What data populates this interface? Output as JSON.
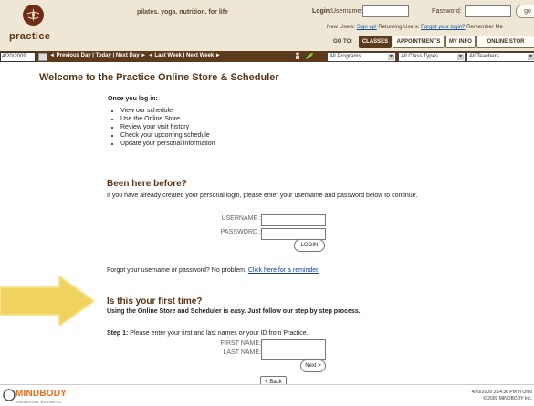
{
  "header": {
    "brand": "practice",
    "tagline": "pilates. yoga. nutrition. for life",
    "login": {
      "label": "Login:",
      "username_label": "Username:",
      "password_label": "Password:",
      "go_label": "go"
    },
    "new_users_text": "New Users:",
    "signup_label": "Sign up!",
    "returning_users_text": "Returning Users:",
    "forgot_login_label": "Forgot your login?",
    "remember_me": "Remember Me",
    "goto_label": "GO TO:",
    "tabs": [
      "CLASSES",
      "APPOINTMENTS",
      "MY INFO",
      "ONLINE STOR"
    ]
  },
  "navbar": {
    "date": "4/20/2009",
    "links": "◄ Previous Day | Today | Next Day ► ◄ Last Week | Next Week ►",
    "programs": "All Programs",
    "class_types": "All Class Types",
    "teachers": "All Teachers"
  },
  "main": {
    "title": "Welcome to the Practice  Online Store & Scheduler",
    "once_logged_in": "Once you log in:",
    "bullets": [
      "View our schedule",
      "Use the Online Store",
      "Review your visit history",
      "Check your upcoming schedule",
      "Update your personal information"
    ],
    "been_here_title": "Been here before?",
    "been_here_text": "If you have already created your personal login, please enter your username and password below to continue.",
    "username_label": "USERNAME :",
    "password_label": "PASSWORD :",
    "login_button": "LOGIN",
    "forgot_text": "Forgot your username or password? No problem.",
    "forgot_link": "Click here for a reminder.",
    "first_time_title": "Is this your first time?",
    "first_time_sub": "Using the Online Store and Scheduler is easy. Just follow our step by step process.",
    "step_label": "Step 1:",
    "step_text": "Please enter your first and last names or your ID from Practice.",
    "first_name_label": "FIRST NAME:",
    "last_name_label": "LAST NAME:",
    "next_button": "Next >",
    "back_button": "< Back"
  },
  "footer": {
    "logo_text": "MINDBODY",
    "logo_sub": "UNIVERSAL BUSINESS",
    "timestamp": "4/20/2009 3:14:36 PM in Ohio",
    "copyright": "© 2009 MINDBODY Inc."
  }
}
